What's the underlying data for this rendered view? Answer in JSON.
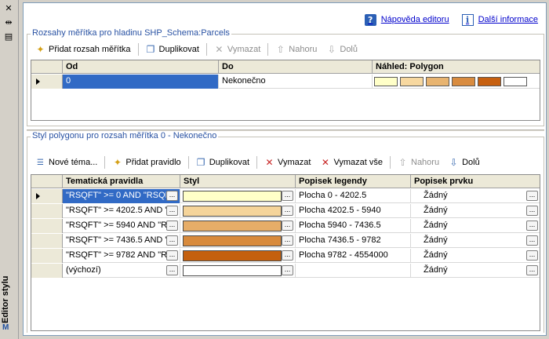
{
  "sidebar": {
    "title": "Editor stylu",
    "logo": "M"
  },
  "help": {
    "editor_help": "Nápověda editoru",
    "more_info": "Další informace"
  },
  "scale_panel": {
    "title": "Rozsahy měřítka pro hladinu SHP_Schema:Parcels",
    "toolbar": {
      "add": "Přidat rozsah měřítka",
      "duplicate": "Duplikovat",
      "delete": "Vymazat",
      "up": "Nahoru",
      "down": "Dolů"
    },
    "columns": [
      "Od",
      "Do",
      "Náhled: Polygon"
    ],
    "rows": [
      {
        "from": "0",
        "to": "Nekonečno",
        "preview": [
          "#ffffc8",
          "#f7d8a0",
          "#e8b470",
          "#d98c40",
          "#c76010",
          "#ffffff"
        ]
      }
    ]
  },
  "style_panel": {
    "title": "Styl polygonu pro rozsah měřítka 0 - Nekonečno",
    "toolbar": {
      "theme": "Nové téma...",
      "add_rule": "Přidat pravidlo",
      "duplicate": "Duplikovat",
      "delete": "Vymazat",
      "delete_all": "Vymazat vše",
      "up": "Nahoru",
      "down": "Dolů"
    },
    "columns": [
      "Tematická pravidla",
      "Styl",
      "Popisek legendy",
      "Popisek prvku"
    ],
    "ellipsis": "...",
    "rows": [
      {
        "rule": "\"RSQFT\" >= 0 AND \"RSQF",
        "color": "#ffffc8",
        "legend": "Plocha 0 - 4202.5",
        "label": "Žádný"
      },
      {
        "rule": "\"RSQFT\" >= 4202.5 AND \"",
        "color": "#f5d49a",
        "legend": "Plocha 4202.5 - 5940",
        "label": "Žádný"
      },
      {
        "rule": "\"RSQFT\" >= 5940 AND \"R",
        "color": "#e6ad68",
        "legend": "Plocha 5940 - 7436.5",
        "label": "Žádný"
      },
      {
        "rule": "\"RSQFT\" >= 7436.5 AND \"",
        "color": "#d88a3c",
        "legend": "Plocha 7436.5 - 9782",
        "label": "Žádný"
      },
      {
        "rule": "\"RSQFT\" >= 9782 AND \"R",
        "color": "#c4600e",
        "legend": "Plocha 9782 - 4554000",
        "label": "Žádný"
      },
      {
        "rule": "(výchozí)",
        "color": "#ffffff",
        "legend": "",
        "label": "Žádný"
      }
    ]
  }
}
